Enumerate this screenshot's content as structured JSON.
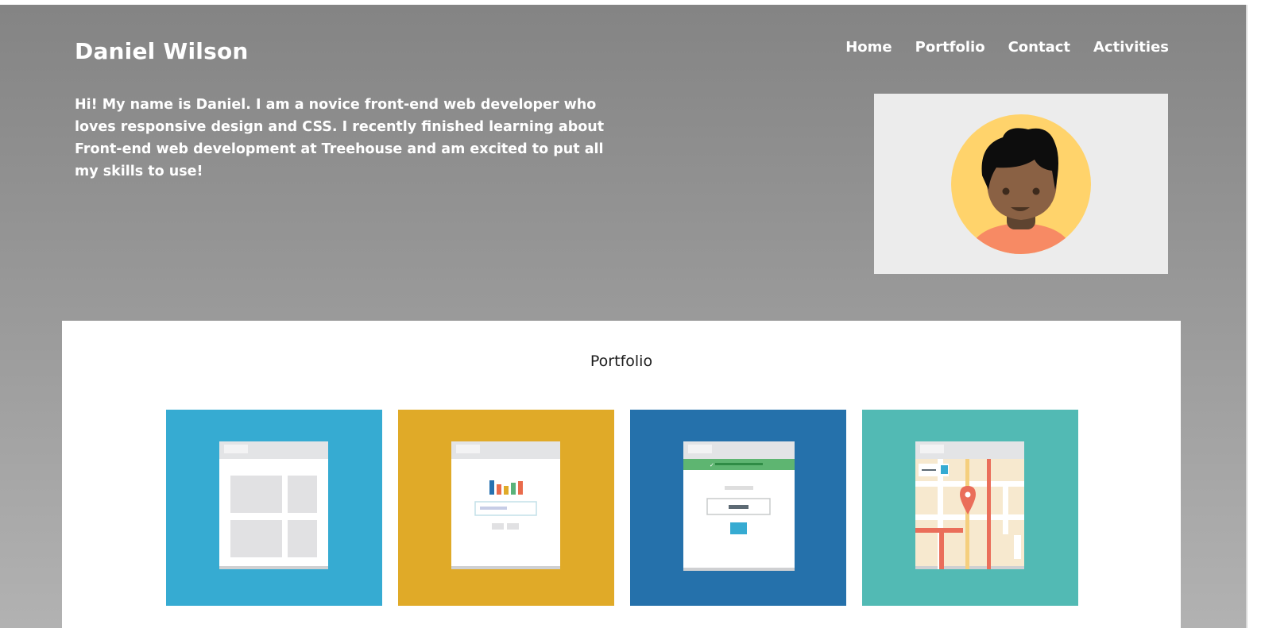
{
  "header": {
    "title": "Daniel Wilson",
    "nav": [
      "Home",
      "Portfolio",
      "Contact",
      "Activities"
    ],
    "intro": "Hi! My name is Daniel. I am a novice front-end web developer who loves responsive design and CSS. I recently finished learning about Front-end web development at Treehouse and am excited to put all my skills to use!"
  },
  "portfolio": {
    "heading": "Portfolio",
    "tiles": [
      {
        "icon": "layout-grid-icon",
        "color": "#36abd2"
      },
      {
        "icon": "bar-chart-page-icon",
        "color": "#e0aa28"
      },
      {
        "icon": "login-form-icon",
        "color": "#2571ab"
      },
      {
        "icon": "map-pin-icon",
        "color": "#52bab4"
      }
    ]
  },
  "colors": {
    "header_gradient_top": "#848484",
    "header_gradient_bottom": "#b2b2b2",
    "avatar_bg": "#ffd36b"
  }
}
